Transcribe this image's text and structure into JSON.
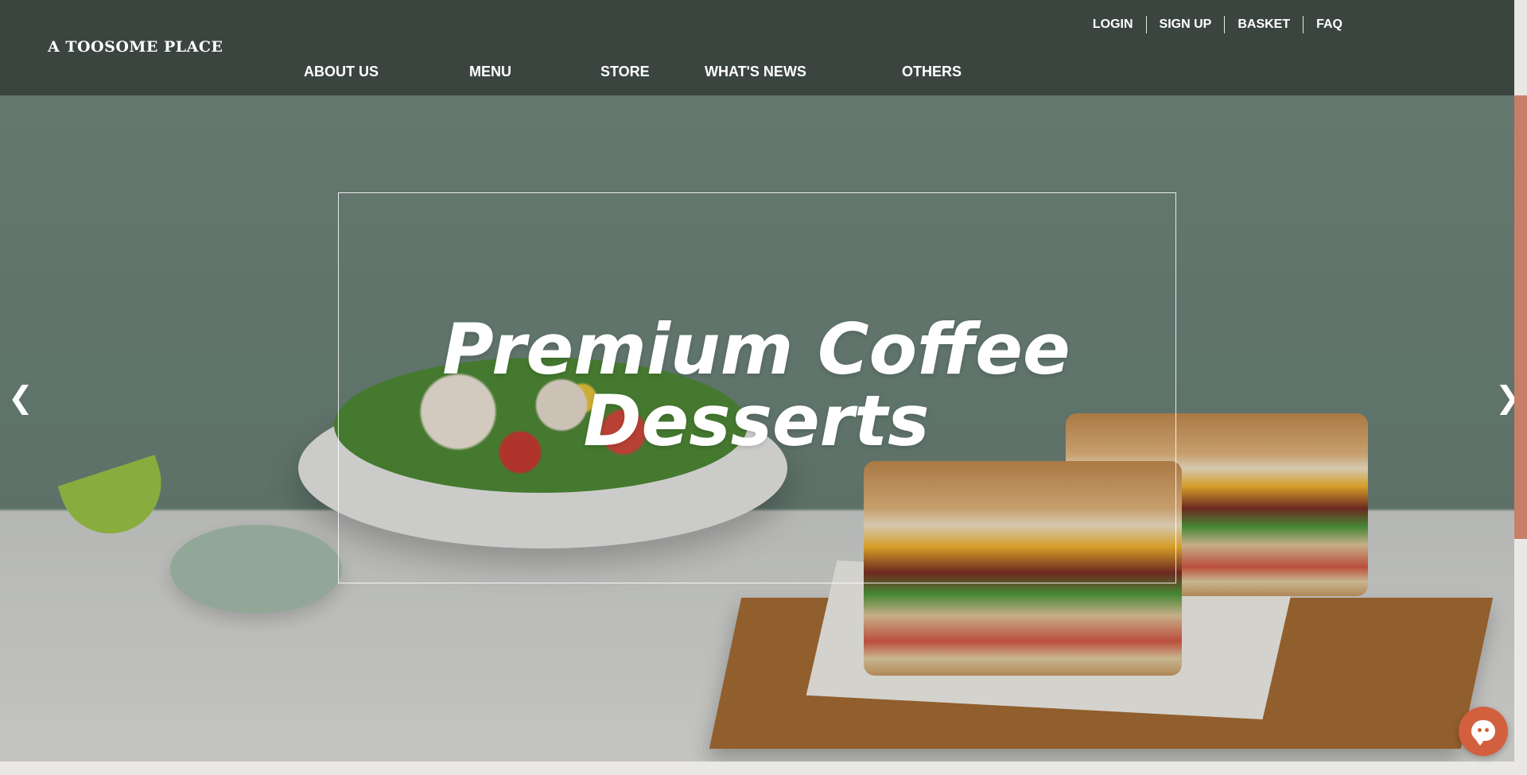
{
  "header": {
    "logo": "A TOOSOME PLACE",
    "util_links": [
      {
        "label": "LOGIN"
      },
      {
        "label": "SIGN UP"
      },
      {
        "label": "BASKET"
      },
      {
        "label": "FAQ"
      }
    ],
    "nav": [
      {
        "label": "ABOUT US"
      },
      {
        "label": "MENU"
      },
      {
        "label": "STORE"
      },
      {
        "label": "WHAT'S NEWS"
      },
      {
        "label": "OTHERS"
      }
    ]
  },
  "hero": {
    "title_line1": "Premium Coffee",
    "title_line2": "Desserts",
    "prev_arrow": "❮",
    "next_arrow": "❯"
  },
  "colors": {
    "header_bg": "#3a4540",
    "accent": "#d2603f",
    "scrollbar": "#c77f6a"
  },
  "icons": {
    "chat": "chat-bubble-icon",
    "prev": "chevron-left-icon",
    "next": "chevron-right-icon"
  }
}
